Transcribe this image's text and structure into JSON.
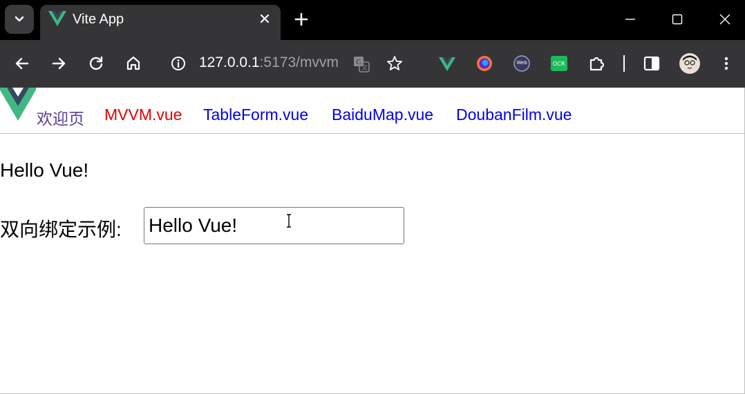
{
  "browser": {
    "tab_title": "Vite App",
    "url_host": "127.0.0.1",
    "url_path": ":5173/mvvm"
  },
  "icons": {
    "tab_search": "chevron-down-icon",
    "tab_favicon": "vue-logo-icon",
    "tab_close": "close-icon",
    "new_tab": "plus-icon",
    "minimize": "minimize-icon",
    "maximize": "maximize-icon",
    "close": "close-icon",
    "back": "back-arrow-icon",
    "forward": "forward-arrow-icon",
    "reload": "reload-icon",
    "home": "home-icon",
    "site_info": "info-icon",
    "translate": "translate-icon",
    "bookmark": "star-icon",
    "extensions": [
      "vue-devtools-icon",
      "firefox-icon",
      "web-icon",
      "ocr-icon",
      "puzzle-extensions-icon"
    ],
    "side_panel": "side-panel-icon",
    "profile": "avatar-icon",
    "menu": "more-vertical-icon"
  },
  "nav": {
    "links": [
      {
        "label": "欢迎页",
        "color": "#5a3e96"
      },
      {
        "label": "MVVM.vue",
        "color": "#e00000"
      },
      {
        "label": "TableForm.vue",
        "color": "#0000ee"
      },
      {
        "label": "BaiduMap.vue",
        "color": "#0000ee"
      },
      {
        "label": "DoubanFilm.vue",
        "color": "#0000ee"
      }
    ]
  },
  "content": {
    "message": "Hello Vue!",
    "binding_label": "双向绑定示例:",
    "binding_value": "Hello Vue!"
  },
  "colors": {
    "vue_green": "#41b883",
    "vue_dark": "#34495e"
  }
}
